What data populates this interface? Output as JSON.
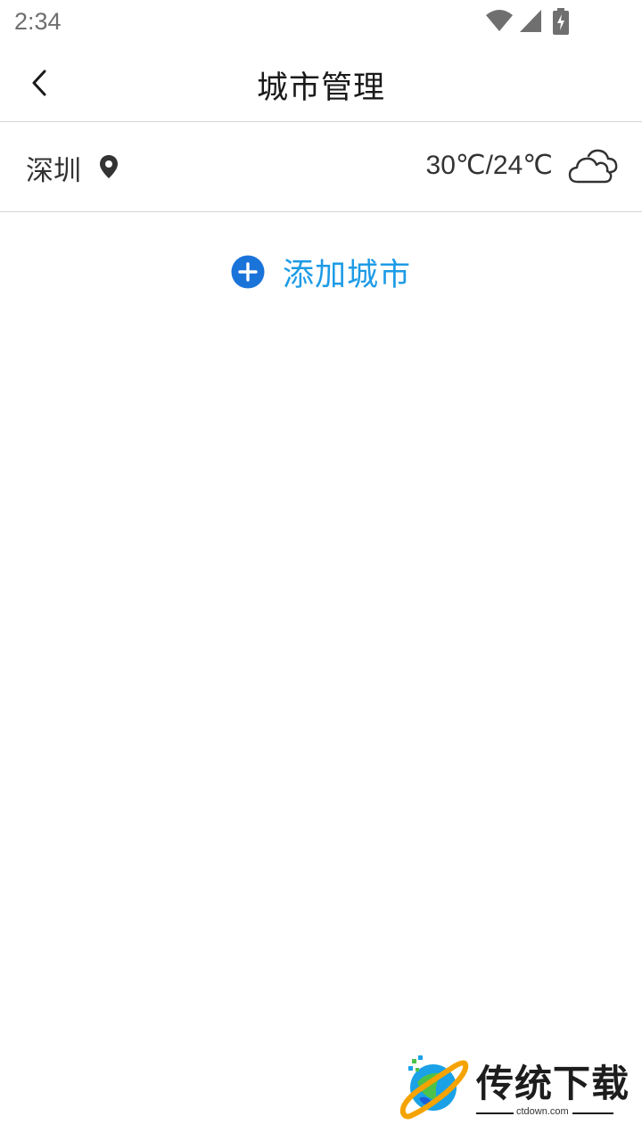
{
  "status_bar": {
    "time": "2:34"
  },
  "header": {
    "back_icon": "chevron-left-icon",
    "title": "城市管理"
  },
  "city": {
    "name": "深圳",
    "location_icon": "location-pin-icon",
    "temperature": "30℃/24℃",
    "weather_icon": "cloudy-icon"
  },
  "add_city": {
    "icon": "plus-circle-icon",
    "label": "添加城市"
  },
  "colors": {
    "accent_blue": "#1e9be6",
    "icon_blue": "#1a73d9",
    "text_dark": "#333333",
    "divider": "#d6d6d6"
  },
  "watermark": {
    "title": "传统下载",
    "subtitle": "ctdown.com"
  }
}
